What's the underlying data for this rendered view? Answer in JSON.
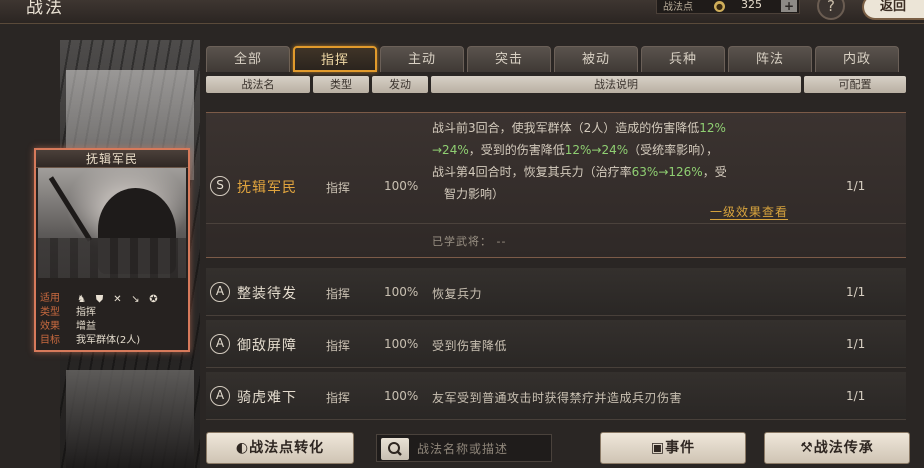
{
  "header": {
    "title": "战法",
    "points_label": "战法点",
    "points_value": "325",
    "plus_label": "+",
    "help_label": "?",
    "back_label": "返回"
  },
  "card": {
    "title": "抚辑军民",
    "rows": [
      {
        "key": "适用",
        "val": ""
      },
      {
        "key": "类型",
        "val": "指挥"
      },
      {
        "key": "效果",
        "val": "增益"
      },
      {
        "key": "目标",
        "val": "我军群体(2人)"
      }
    ],
    "unit_icons": [
      "cavalry-icon",
      "shield-icon",
      "bow-icon",
      "spear-icon",
      "chariot-icon"
    ]
  },
  "tabs": [
    "全部",
    "指挥",
    "主动",
    "突击",
    "被动",
    "兵种",
    "阵法",
    "内政"
  ],
  "active_tab": 1,
  "columns": [
    "战法名",
    "类型",
    "发动",
    "战法说明",
    "可配置"
  ],
  "selected": {
    "grade": "S",
    "name": "抚辑军民",
    "type": "指挥",
    "rate": "100%",
    "count": "1/1",
    "desc_parts": {
      "l1a": "战斗前3回合，使我军群体（2人）造成的伤害降低",
      "l1b": "12%",
      "l2a": "→24%",
      "l2b": "，受到的伤害降低",
      "l2c": "12%→24%",
      "l2d": "（受统率影响），",
      "l3a": "战斗第4回合时，恢复其兵力（治疗率",
      "l3b": "63%→126%",
      "l3c": "，受",
      "l4": "智力影响）"
    },
    "effect_link": "一级效果查看",
    "learned": "已学武将：  --"
  },
  "skills": [
    {
      "grade": "A",
      "name": "整装待发",
      "type": "指挥",
      "rate": "100%",
      "desc": "恢复兵力",
      "count": "1/1"
    },
    {
      "grade": "A",
      "name": "御敌屏障",
      "type": "指挥",
      "rate": "100%",
      "desc": "受到伤害降低",
      "count": "1/1"
    },
    {
      "grade": "A",
      "name": "骑虎难下",
      "type": "指挥",
      "rate": "100%",
      "desc": "友军受到普通攻击时获得禁疗并造成兵刃伤害",
      "count": "1/1"
    }
  ],
  "bottom": {
    "convert_label": "战法点转化",
    "search_placeholder": "战法名称或描述",
    "event_label": "事件",
    "inherit_label": "战法传承"
  }
}
